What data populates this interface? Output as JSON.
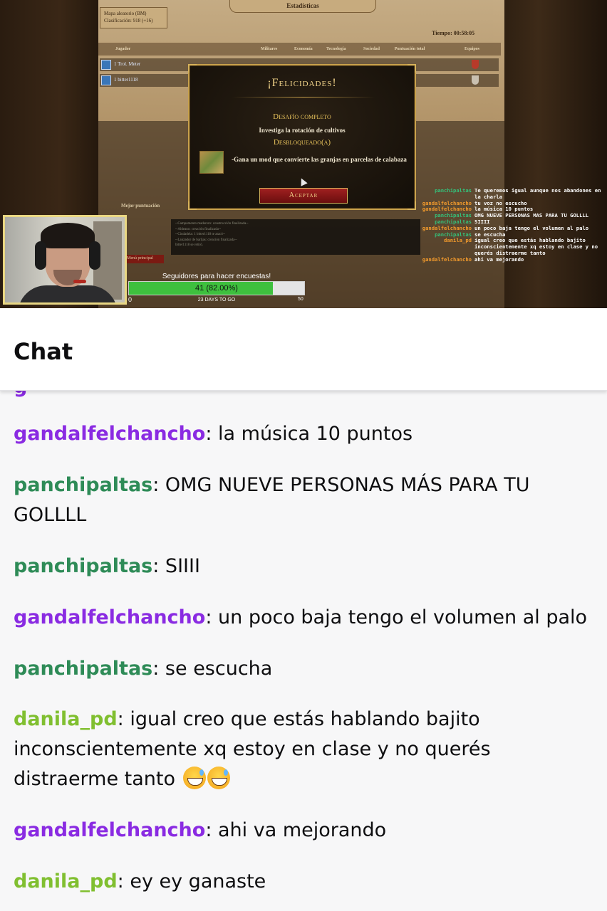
{
  "stream": {
    "map_info": {
      "line1": "Mapa aleatorio (BM)",
      "line2": "Clasificación: 918 (+16)"
    },
    "stats_title": "Estadísticas",
    "timer": "Tiempo: 00:58:05",
    "table_headers": [
      "Jugador",
      "Militares",
      "Economía",
      "Tecnología",
      "Sociedad",
      "Puntuación total",
      "Equipos"
    ],
    "players": [
      "1 Trol. Meter",
      "1 bitter1118"
    ],
    "modal": {
      "title": "¡Felicidades!",
      "subtitle": "Desafío completo",
      "description": "Investiga la rotación de cultivos",
      "unlocked": "Desbloqueado(a)",
      "reward": "-Gana un mod que convierte las granjas en parcelas de calabaza",
      "button": "Aceptar"
    },
    "best_score_label": "Mejor puntuación",
    "log_lines": [
      "--Campamento maderero: construcción finalizada--",
      "--Aldeano: creación finalizada--",
      "--Ciudadela: 1 bitter1118 te atacó--",
      "--Lanzador de barljas: creación finalizada--",
      "bitter1118 se retiró."
    ],
    "menu_tab": "Menú principal",
    "goal": {
      "label": "Seguidores para hacer encuestas!",
      "value_text": "41 (82.00%)",
      "progress": 0.82,
      "min": "0",
      "max": "50",
      "days": "23 DAYS TO GO",
      "fill_color": "#3ec03e"
    },
    "overlay_chat": [
      {
        "user": "panchipaltas",
        "color": "green",
        "text": "Te queremos igual aunque nos abandones en la charla"
      },
      {
        "user": "gandalfelchancho",
        "color": "orange",
        "text": "tu voz no escucho"
      },
      {
        "user": "gandalfelchancho",
        "color": "orange",
        "text": "la música 10 puntos"
      },
      {
        "user": "panchipaltas",
        "color": "green",
        "text": "OMG NUEVE PERSONAS MAS PARA TU GOLLLL"
      },
      {
        "user": "panchipaltas",
        "color": "green",
        "text": "SIIII"
      },
      {
        "user": "gandalfelchancho",
        "color": "orange",
        "text": "un poco baja tengo el volumen al palo"
      },
      {
        "user": "panchipaltas",
        "color": "green",
        "text": "se escucha"
      },
      {
        "user": "danila_pd",
        "color": "orange",
        "text": "igual creo que estás hablando bajito inconscientemente xq estoy en clase y no querés distraerme tanto"
      },
      {
        "user": "gandalfelchancho",
        "color": "orange",
        "text": "ahi va mejorando"
      }
    ]
  },
  "chat": {
    "title": "Chat",
    "messages": [
      {
        "user": "gandalfelchancho",
        "color": "purple",
        "text": ": la música 10 puntos"
      },
      {
        "user": "panchipaltas",
        "color": "green",
        "text": ": OMG NUEVE PERSONAS MÁS PARA TU GOLLLL"
      },
      {
        "user": "panchipaltas",
        "color": "green",
        "text": ": SIIII"
      },
      {
        "user": "gandalfelchancho",
        "color": "purple",
        "text": ": un poco baja tengo el volumen al palo"
      },
      {
        "user": "panchipaltas",
        "color": "green",
        "text": ": se escucha"
      },
      {
        "user": "danila_pd",
        "color": "lime",
        "text": ": igual creo que estás hablando bajito inconscientemente xq estoy en clase y no querés distraerme tanto",
        "emoji": "sweat-smile-emoji"
      },
      {
        "user": "gandalfelchancho",
        "color": "purple",
        "text": ": ahi va mejorando"
      },
      {
        "user": "danila_pd",
        "color": "lime",
        "text": ": ey ey ganaste"
      }
    ],
    "colors": {
      "purple": "#8a2be2",
      "green": "#2e8b57",
      "lime": "#80bf30"
    }
  }
}
